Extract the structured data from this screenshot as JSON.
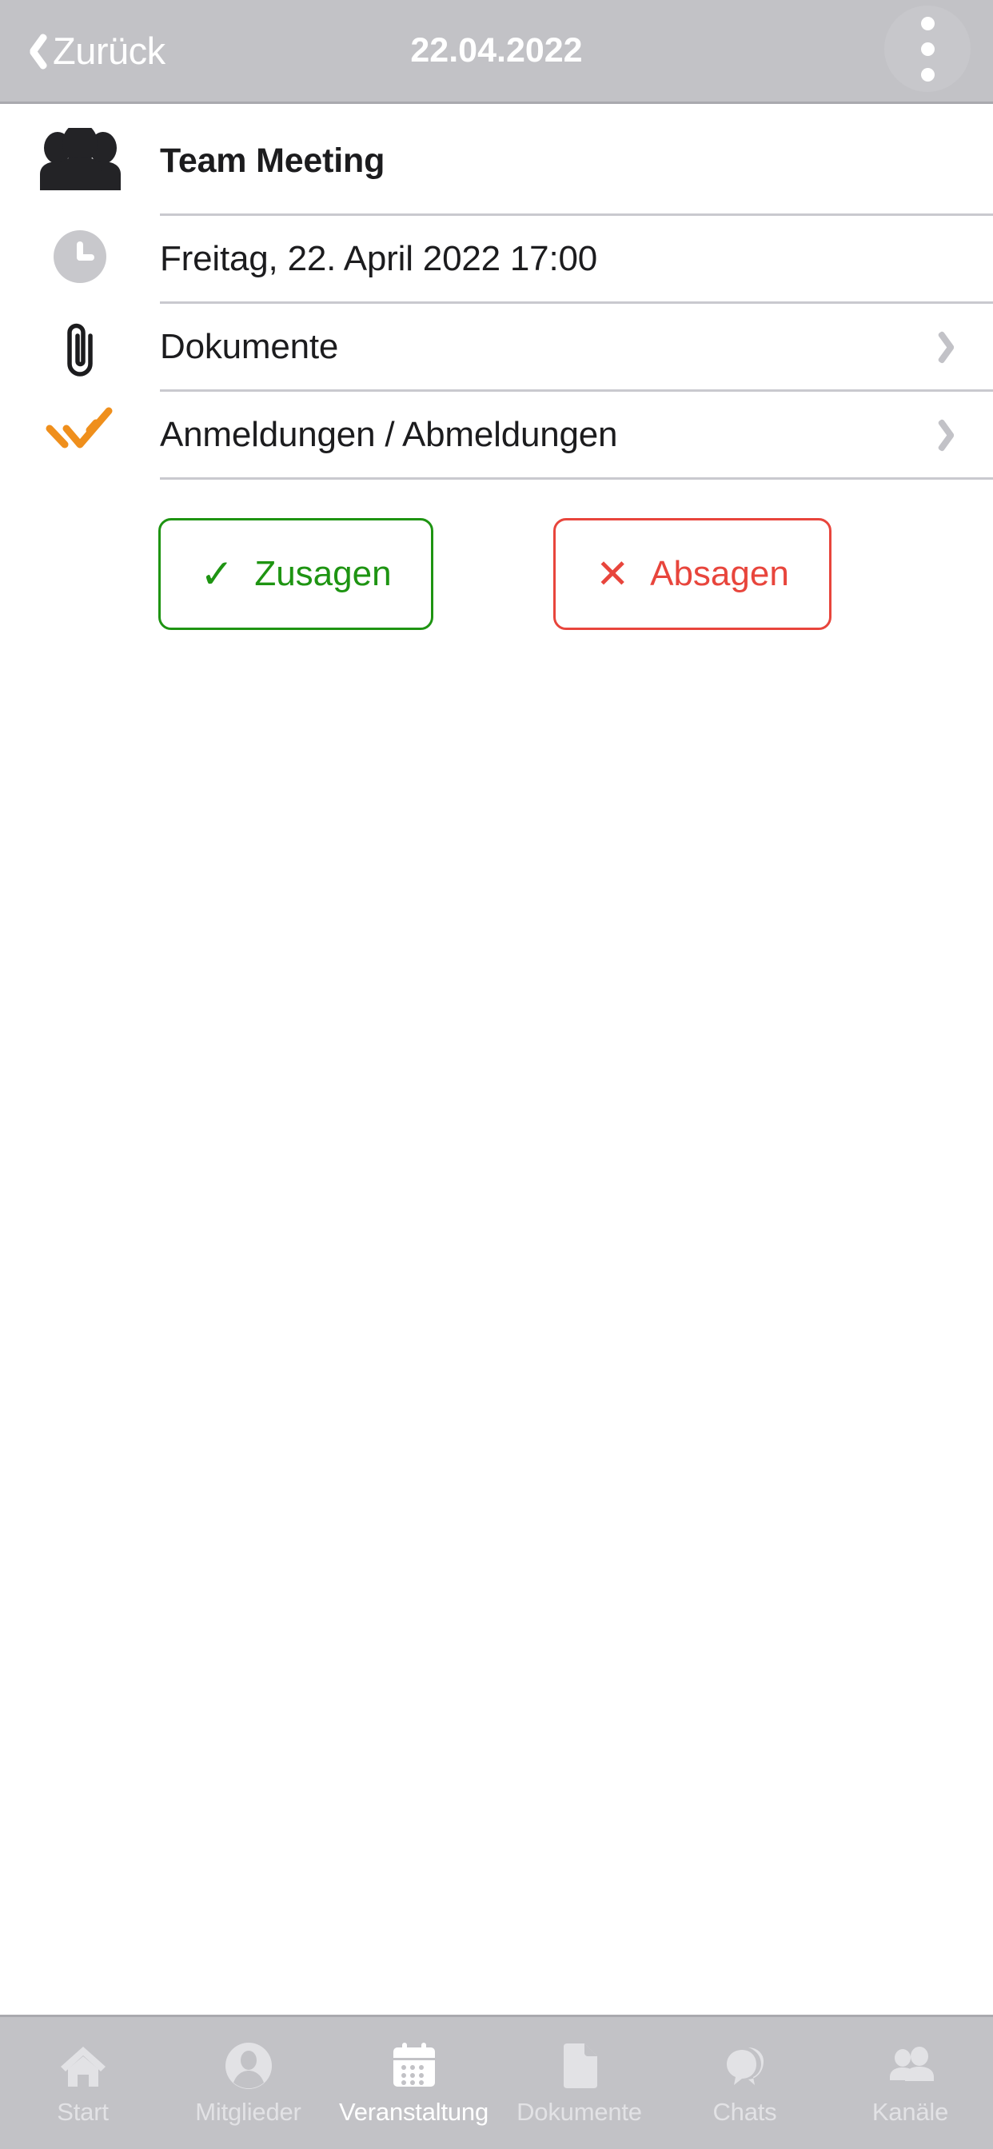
{
  "topbar": {
    "back_label": "Zurück",
    "back_icon": "chevron-left-icon",
    "title": "22.04.2022",
    "menu_icon": "overflow-menu-icon",
    "bg_color": "#c2c2c6",
    "text_color": "#ffffff"
  },
  "event": {
    "rows": [
      {
        "icon": "group-people-icon",
        "title": "Team Meeting",
        "bold": true,
        "chevron": false
      },
      {
        "icon": "clock-icon",
        "title": "Freitag, 22. April 2022 17:00",
        "bold": false,
        "chevron": false
      },
      {
        "icon": "paperclip-icon",
        "title": "Dokumente",
        "bold": false,
        "chevron": true
      },
      {
        "icon": "double-check-icon",
        "title": "Anmeldungen / Abmeldungen",
        "bold": false,
        "chevron": true
      }
    ]
  },
  "actions": {
    "accept": {
      "label": "Zusagen",
      "glyph": "✓",
      "icon": "check-icon",
      "color": "#1e9412"
    },
    "decline": {
      "label": "Absagen",
      "glyph": "✕",
      "icon": "cross-icon",
      "color": "#e8453c"
    }
  },
  "tabbar": {
    "active_index": 2,
    "items": [
      {
        "label": "Start",
        "icon": "home-icon"
      },
      {
        "label": "Mitglieder",
        "icon": "person-circle-icon"
      },
      {
        "label": "Veranstaltung",
        "icon": "calendar-icon"
      },
      {
        "label": "Dokumente",
        "icon": "document-icon"
      },
      {
        "label": "Chats",
        "icon": "chat-bubbles-icon"
      },
      {
        "label": "Kanäle",
        "icon": "people-icon"
      }
    ]
  },
  "colors": {
    "accent_orange": "#ef8f1c",
    "divider": "#c9c9cf",
    "chevron": "#c2c2c7",
    "icon_dark": "#232326",
    "clock_gray": "#c8c8cc"
  }
}
